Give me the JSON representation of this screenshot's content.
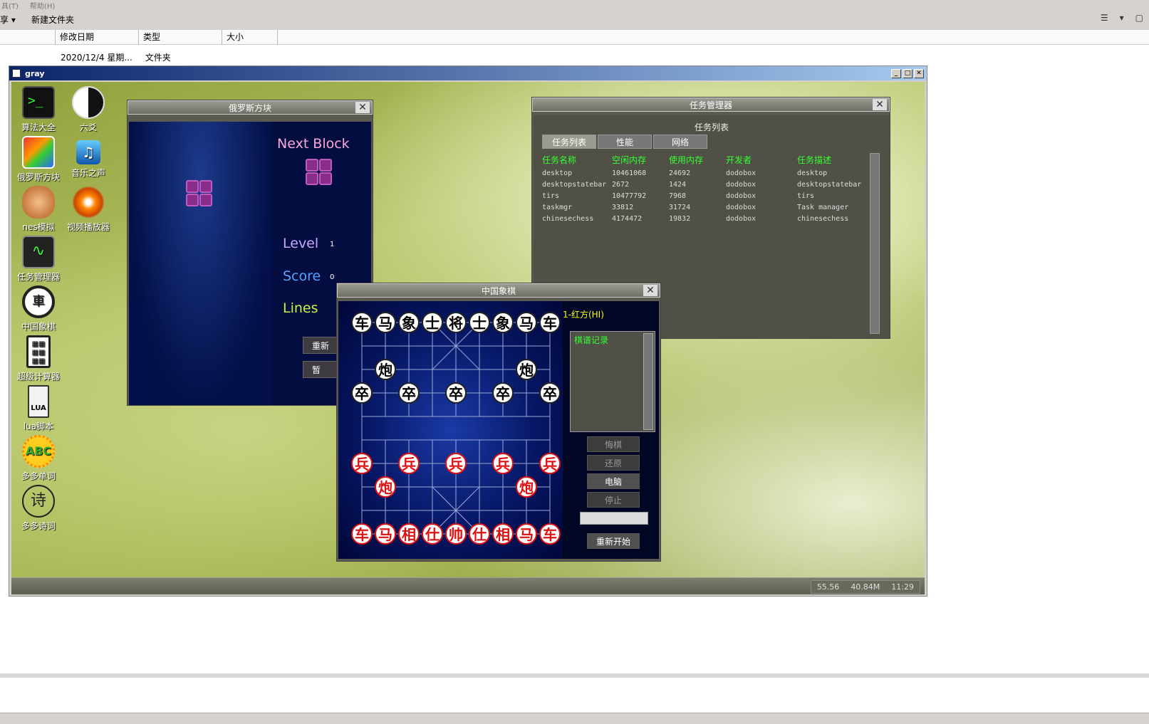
{
  "explorer": {
    "menu": [
      "具(T)",
      "帮助(H)"
    ],
    "toolbar": {
      "left_label": "享",
      "new_folder": "新建文件夹"
    },
    "columns": [
      "修改日期",
      "类型",
      "大小"
    ],
    "file_row": {
      "date": "2020/12/4 星期...",
      "type": "文件夹"
    }
  },
  "gray_window": {
    "title": "gray",
    "controls": [
      "_",
      "□",
      "✕"
    ]
  },
  "desktop_icons": [
    {
      "label": "算法大全",
      "icon": "terminal-icon"
    },
    {
      "label": "六爻",
      "icon": "yinyang-icon"
    },
    {
      "label": "俄罗斯方块",
      "icon": "tetris-icon"
    },
    {
      "label": "音乐之声",
      "icon": "music-icon"
    },
    {
      "label": "nes模拟",
      "icon": "nes-icon"
    },
    {
      "label": "视频播放器",
      "icon": "video-icon"
    },
    {
      "label": "任务管理器",
      "icon": "pulse-icon"
    },
    {
      "label": "中国象棋",
      "icon": "chess-icon"
    },
    {
      "label": "超级计算器",
      "icon": "calculator-icon"
    },
    {
      "label": "lua脚本",
      "icon": "lua-icon"
    },
    {
      "label": "多多单词",
      "icon": "abc-icon"
    },
    {
      "label": "多多诗词",
      "icon": "poem-icon"
    }
  ],
  "tetris": {
    "title": "俄罗斯方块",
    "next_label": "Next Block",
    "level_label": "Level",
    "level": "1",
    "score_label": "Score",
    "score": "0",
    "lines_label": "Lines",
    "btn_restart": "重新",
    "btn_pause": "暂"
  },
  "taskmgr": {
    "title": "任务管理器",
    "heading": "任务列表",
    "tabs": [
      "任务列表",
      "性能",
      "网络"
    ],
    "columns": [
      "任务名称",
      "空闲内存",
      "使用内存",
      "开发者",
      "任务描述"
    ],
    "rows": [
      [
        "desktop",
        "10461068",
        "24692",
        "dodobox",
        "desktop"
      ],
      [
        "desktopstatebar",
        "2672",
        "1424",
        "dodobox",
        "desktopstatebar"
      ],
      [
        "tirs",
        "10477792",
        "7968",
        "dodobox",
        "tirs"
      ],
      [
        "taskmgr",
        "33812",
        "31724",
        "dodobox",
        "Task manager"
      ],
      [
        "chinesechess",
        "4174472",
        "19832",
        "dodobox",
        "chinesechess"
      ]
    ]
  },
  "chess": {
    "title": "中国象棋",
    "turn": "1-红方(HI)",
    "record_label": "棋谱记录",
    "btn_undo": "悔棋",
    "btn_restore": "还原",
    "btn_computer": "电脑",
    "btn_stop": "停止",
    "btn_restart": "重新开始",
    "black_back": [
      "车",
      "马",
      "象",
      "士",
      "将",
      "士",
      "象",
      "马",
      "车"
    ],
    "black_cannon": "炮",
    "black_pawn": "卒",
    "red_back": [
      "车",
      "马",
      "相",
      "仕",
      "帅",
      "仕",
      "相",
      "马",
      "车"
    ],
    "red_cannon": "炮",
    "red_pawn": "兵"
  },
  "taskbar": {
    "fps": "55.56",
    "mem": "40.84M",
    "time": "11:29"
  }
}
